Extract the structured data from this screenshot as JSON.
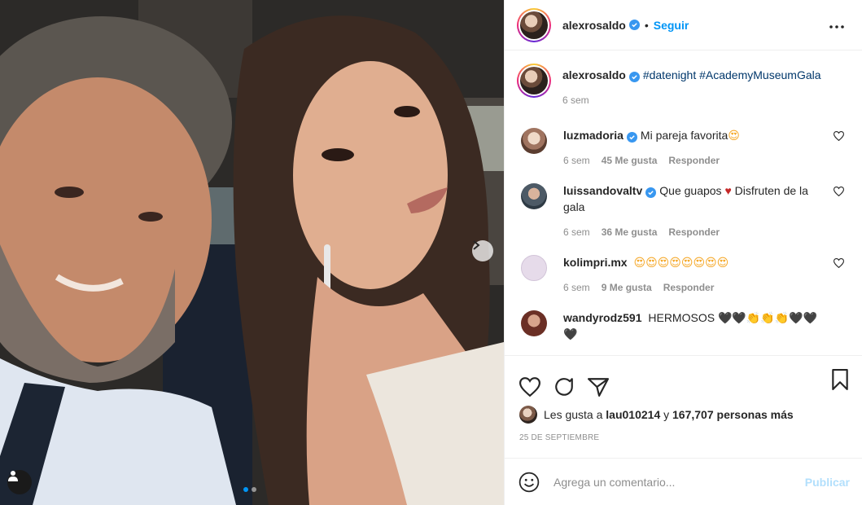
{
  "post": {
    "username": "alexrosaldo",
    "follow_label": "Seguir",
    "separator": "•",
    "caption_hashtags": "#datenight #AcademyMuseumGala",
    "caption_time": "6 sem",
    "likes_prefix": "Les gusta a",
    "likes_user": "lau010214",
    "likes_and": "y",
    "likes_count": "167,707 personas más",
    "date": "25 DE SEPTIEMBRE",
    "comment_placeholder": "Agrega un comentario...",
    "publish_label": "Publicar"
  },
  "comments": [
    {
      "username": "luzmadoria",
      "verified": true,
      "text": "Mi pareja favorita",
      "emoji": "😍",
      "time": "6 sem",
      "likes": "45 Me gusta",
      "reply": "Responder",
      "avatar_color": "#c9a690"
    },
    {
      "username": "luissandovaltv",
      "verified": true,
      "text": "Que guapos",
      "heart": "♥",
      "text2": "Disfruten de la gala",
      "time": "6 sem",
      "likes": "36 Me gusta",
      "reply": "Responder",
      "avatar_color": "#6b7d8c"
    },
    {
      "username": "kolimpri.mx",
      "verified": false,
      "text": "😍😍😍😍😍😍😍😍",
      "time": "6 sem",
      "likes": "9 Me gusta",
      "reply": "Responder",
      "avatar_color": "#d9cde0"
    },
    {
      "username": "wandyrodz591",
      "verified": false,
      "text": "HERMOSOS 🖤🖤👏👏👏🖤🖤🖤",
      "avatar_color": "#8a4a3a"
    }
  ],
  "icons": {
    "more": "more-options-icon",
    "like": "heart-icon",
    "comment": "comment-bubble-icon",
    "share": "paper-plane-icon",
    "save": "bookmark-icon",
    "emoji": "smiley-icon",
    "next": "chevron-right-icon",
    "tag": "user-tag-icon"
  },
  "colors": {
    "accent": "#0095f6",
    "publish_disabled": "#b2dffc",
    "verified": "#3897f0",
    "muted": "#8e8e8e"
  },
  "carousel": {
    "current": 1,
    "total": 2
  }
}
